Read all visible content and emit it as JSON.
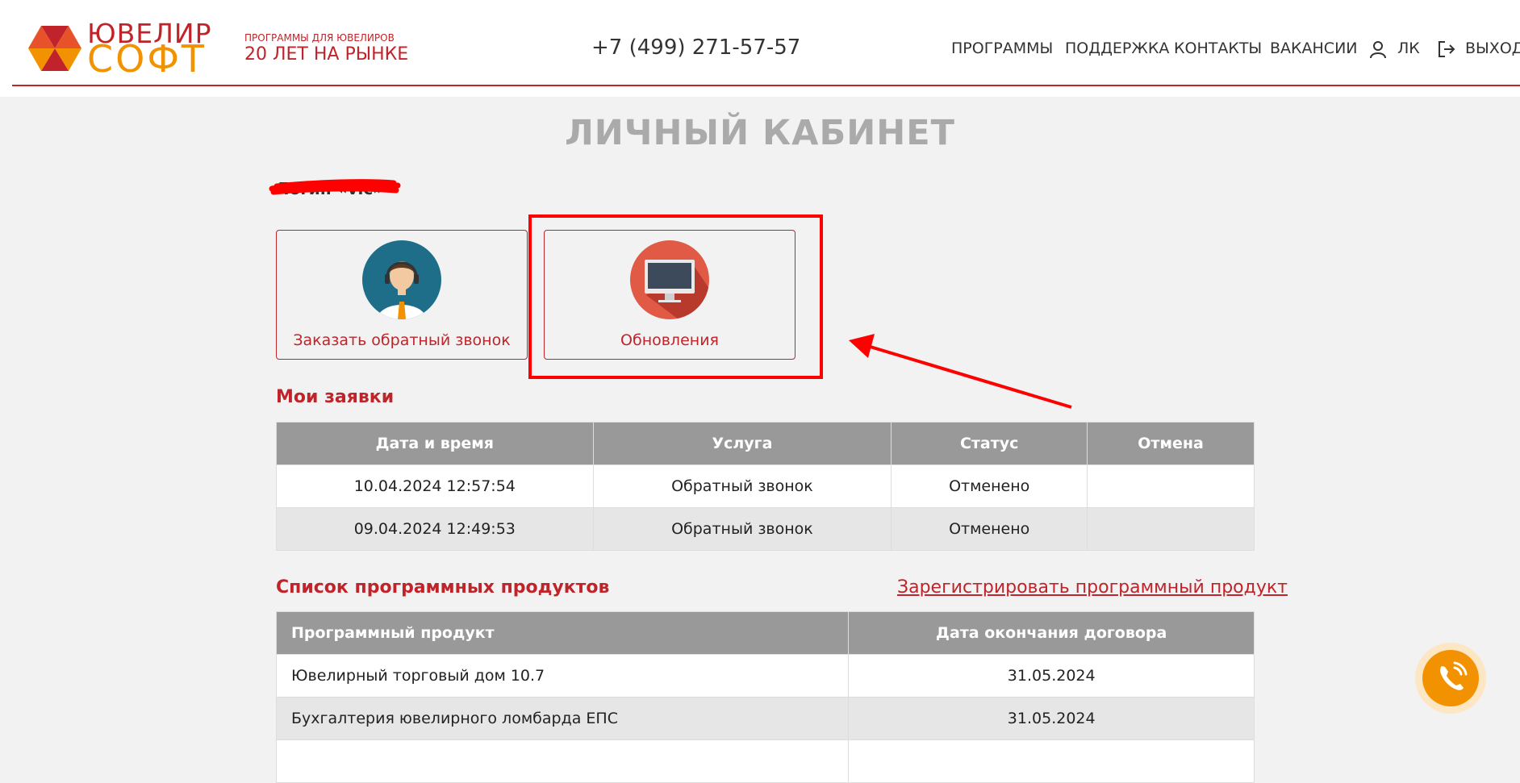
{
  "header": {
    "logo_top": "ЮВЕЛИР",
    "logo_bottom": "СОФТ",
    "tagline_small": "ПРОГРАММЫ ДЛЯ ЮВЕЛИРОВ",
    "tagline_big": "20 ЛЕТ НА РЫНКЕ",
    "phone": "+7 (499) 271-57-57",
    "nav": [
      "ПРОГРАММЫ",
      "ПОДДЕРЖКА",
      "КОНТАКТЫ",
      "ВАКАНСИИ",
      "ЛК",
      "ВЫХОД"
    ]
  },
  "page": {
    "title": "ЛИЧНЫЙ КАБИНЕТ",
    "login": "Логин «viс»"
  },
  "cards": [
    {
      "label": "Заказать обратный звонок",
      "icon": "support-operator-icon"
    },
    {
      "label": "Обновления",
      "icon": "monitor-icon"
    }
  ],
  "requests": {
    "title": "Мои заявки",
    "headers": [
      "Дата и время",
      "Услуга",
      "Статус",
      "Отмена"
    ],
    "rows": [
      [
        "10.04.2024 12:57:54",
        "Обратный звонок",
        "Отменено",
        ""
      ],
      [
        "09.04.2024 12:49:53",
        "Обратный звонок",
        "Отменено",
        ""
      ]
    ]
  },
  "products": {
    "title": "Список программных продуктов",
    "register_link": "Зарегистрировать программный продукт",
    "headers": [
      "Программный продукт",
      "Дата окончания договора"
    ],
    "rows": [
      [
        "Ювелирный торговый дом 10.7",
        "31.05.2024"
      ],
      [
        "Бухгалтерия ювелирного ломбарда ЕПС",
        "31.05.2024"
      ]
    ]
  },
  "colors": {
    "brand_red": "#c0242a",
    "brand_orange": "#f39200",
    "annotation_red": "#ff0000"
  }
}
